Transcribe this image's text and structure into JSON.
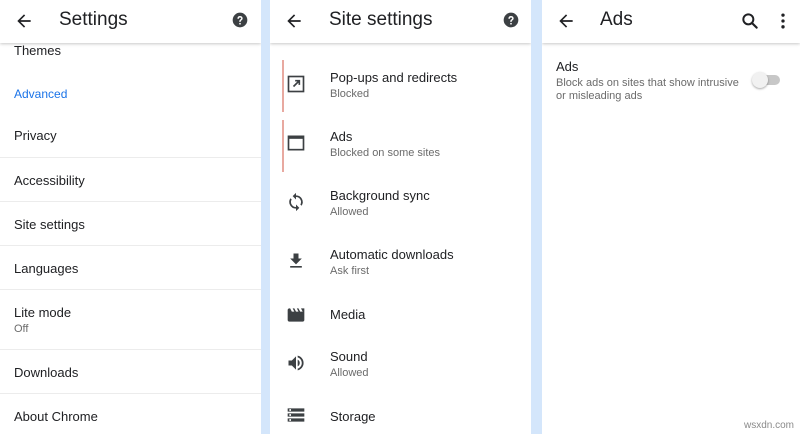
{
  "panel_settings": {
    "title": "Settings",
    "partial_item": "Themes",
    "section_header": "Advanced",
    "items": [
      {
        "label": "Privacy"
      },
      {
        "label": "Accessibility"
      },
      {
        "label": "Site settings"
      },
      {
        "label": "Languages"
      },
      {
        "label": "Lite mode",
        "sub": "Off"
      },
      {
        "label": "Downloads"
      },
      {
        "label": "About Chrome"
      }
    ]
  },
  "panel_site_settings": {
    "title": "Site settings",
    "items": [
      {
        "label": "Pop-ups and redirects",
        "sub": "Blocked",
        "icon": "open-in-new-icon"
      },
      {
        "label": "Ads",
        "sub": "Blocked on some sites",
        "icon": "ads-window-icon"
      },
      {
        "label": "Background sync",
        "sub": "Allowed",
        "icon": "sync-icon"
      },
      {
        "label": "Automatic downloads",
        "sub": "Ask first",
        "icon": "download-icon"
      },
      {
        "label": "Media",
        "icon": "movie-icon"
      },
      {
        "label": "Sound",
        "sub": "Allowed",
        "icon": "volume-icon"
      },
      {
        "label": "Storage",
        "icon": "storage-icon"
      }
    ]
  },
  "panel_ads": {
    "title": "Ads",
    "setting_title": "Ads",
    "setting_description": "Block ads on sites that show intrusive or misleading ads",
    "toggle_state": "off"
  },
  "watermark": "wsxdn.com",
  "colors": {
    "accent": "#1a73e8",
    "gap": "#d4e6fb",
    "subtext": "#6b6b6b"
  }
}
